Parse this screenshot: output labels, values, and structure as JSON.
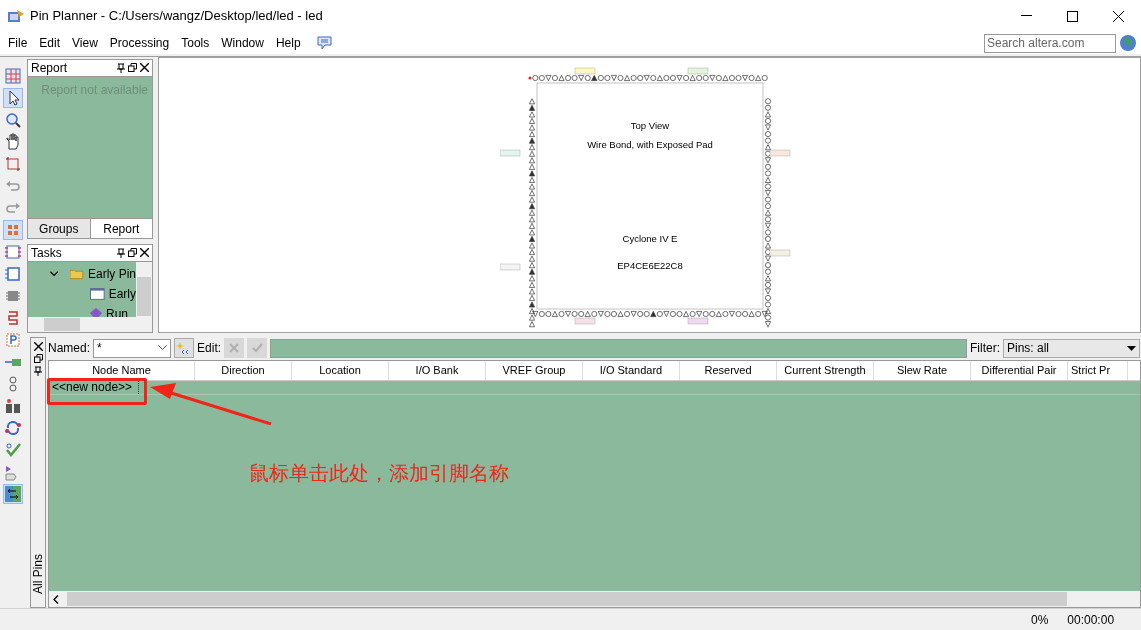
{
  "window": {
    "title": "Pin Planner - C:/Users/wangz/Desktop/led/led - led"
  },
  "menu": [
    "File",
    "Edit",
    "View",
    "Processing",
    "Tools",
    "Window",
    "Help"
  ],
  "search": {
    "placeholder": "Search altera.com"
  },
  "report_panel": {
    "title": "Report",
    "message": "Report not available"
  },
  "panel_tabs": [
    {
      "label": "Groups",
      "selected": false
    },
    {
      "label": "Report",
      "selected": true
    }
  ],
  "tasks_panel": {
    "title": "Tasks",
    "items": [
      {
        "label": "Early Pin",
        "expanded": true,
        "children": [
          {
            "label": "Early"
          },
          {
            "label": "Run"
          }
        ]
      }
    ]
  },
  "package_view": {
    "labels": [
      "Top View",
      "Wire Bond, with Exposed Pad",
      "Cyclone IV E",
      "EP4CE6E22C8"
    ]
  },
  "pin_table": {
    "named_label": "Named:",
    "named_value": "*",
    "edit_label": "Edit:",
    "filter_label": "Filter:",
    "filter_value": "Pins: all",
    "side_label": "All Pins",
    "columns": [
      "Node Name",
      "Direction",
      "Location",
      "I/O Bank",
      "VREF Group",
      "I/O Standard",
      "Reserved",
      "Current Strength",
      "Slew Rate",
      "Differential Pair",
      "Strict Pr"
    ],
    "rows": [
      {
        "node_name": "<<new node>>"
      }
    ]
  },
  "annotation": {
    "text": "鼠标单击此处，添加引脚名称"
  },
  "status_bar": {
    "progress": "0%",
    "time": "00:00:00"
  }
}
